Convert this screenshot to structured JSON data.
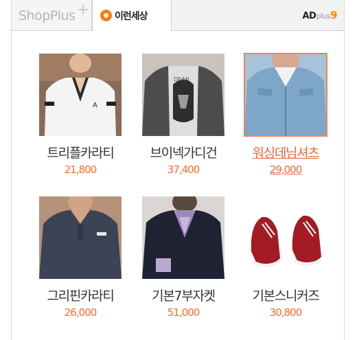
{
  "tabs": {
    "shopplus_label": "ShopPlus",
    "shopplus_plus": "+",
    "active_label": "이런세상",
    "adplus_brand": "AD",
    "adplus_word": "plus",
    "adplus_num": "9"
  },
  "products": [
    {
      "name": "트리플카라티",
      "price": "21,800"
    },
    {
      "name": "브이넥가디건",
      "price": "37,400"
    },
    {
      "name": "워싱데님셔츠",
      "price": "29,000",
      "highlighted": true
    },
    {
      "name": "그리핀카라티",
      "price": "26,000"
    },
    {
      "name": "기본7부자켓",
      "price": "51,000"
    },
    {
      "name": "기본스니커즈",
      "price": "30,800"
    }
  ],
  "colors": {
    "price": "#ff6a2a",
    "highlight": "#f0663a",
    "logo_orange": "#ff7a00"
  }
}
